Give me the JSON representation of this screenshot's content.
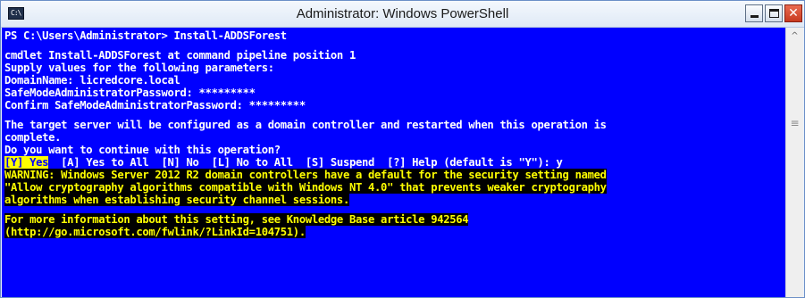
{
  "window": {
    "title": "Administrator: Windows PowerShell",
    "icon_name": "powershell-icon",
    "icon_text": "C:\\",
    "controls": {
      "minimize_icon": "minimize-icon",
      "maximize_icon": "maximize-icon",
      "close_icon": "close-icon",
      "close_glyph": "✕"
    }
  },
  "console": {
    "background": "#0000ff",
    "foreground": "#ffffff",
    "lines": {
      "prompt": "PS C:\\Users\\Administrator> Install-ADDSForest",
      "cmdlet_header": "cmdlet Install-ADDSForest at command pipeline position 1",
      "supply_params": "Supply values for the following parameters:",
      "domain_name": "DomainName: licredcore.local",
      "safe_mode_pw": "SafeModeAdministratorPassword: *********",
      "confirm_pw": "Confirm SafeModeAdministratorPassword: *********",
      "target_server_1": "The target server will be configured as a domain controller and restarted when this operation is",
      "target_server_2": "complete.",
      "continue_question": "Do you want to continue with this operation?",
      "choice_yes": "[Y] Yes",
      "choice_rest": "  [A] Yes to All  [N] No  [L] No to All  [S] Suspend  [?] Help (default is \"Y\"): y",
      "warning_1": "WARNING: Windows Server 2012 R2 domain controllers have a default for the security setting named",
      "warning_2": "\"Allow cryptography algorithms compatible with Windows NT 4.0\" that prevents weaker cryptography",
      "warning_3": "algorithms when establishing security channel sessions.",
      "info_1": "For more information about this setting, see Knowledge Base article 942564",
      "info_2": "(http://go.microsoft.com/fwlink/?LinkId=104751)."
    }
  },
  "scrollbar": {
    "up_arrow": "^",
    "up_icon": "scroll-up-arrow-icon",
    "grip": "≡",
    "grip_icon": "scroll-grip-icon"
  },
  "colors": {
    "console_bg": "#0000ff",
    "warning_bg": "#000000",
    "warning_fg": "#ffff00",
    "highlight_bg": "#ffff00",
    "highlight_fg": "#0000ff",
    "close_button": "#c73a20"
  }
}
